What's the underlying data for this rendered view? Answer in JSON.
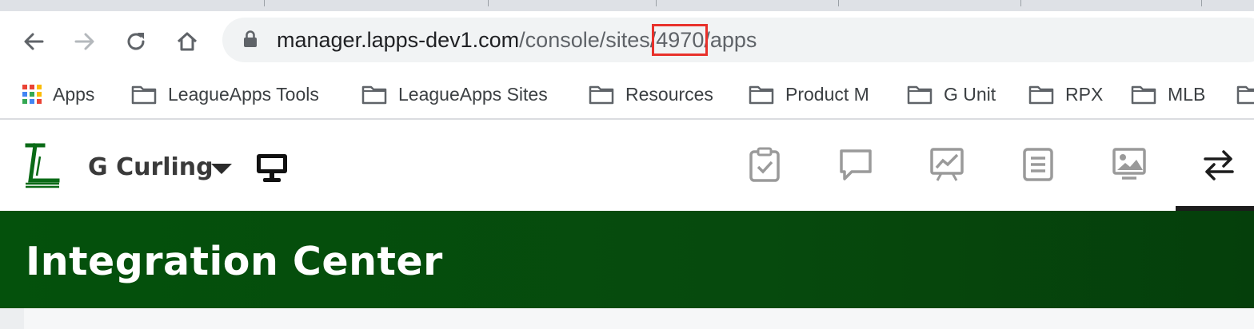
{
  "browser": {
    "url_host": "manager.lapps-dev1.com",
    "url_path_1": "/console/sites/",
    "url_site_id": "4970",
    "url_path_2": "/apps"
  },
  "bookmarks": [
    {
      "label": "Apps",
      "icon": "apps-grid-icon"
    },
    {
      "label": "LeagueApps Tools",
      "icon": "folder-icon"
    },
    {
      "label": "LeagueApps Sites",
      "icon": "folder-icon"
    },
    {
      "label": "Resources",
      "icon": "folder-icon"
    },
    {
      "label": "Product M",
      "icon": "folder-icon"
    },
    {
      "label": "G Unit",
      "icon": "folder-icon"
    },
    {
      "label": "RPX",
      "icon": "folder-icon"
    },
    {
      "label": "MLB",
      "icon": "folder-icon"
    }
  ],
  "app": {
    "site_name": "G Curling",
    "nav_icons": [
      "clipboard-check-icon",
      "chat-bubble-icon",
      "analytics-chart-icon",
      "list-document-icon",
      "image-gallery-icon",
      "integrations-arrows-icon"
    ],
    "active_nav": "integrations-arrows-icon"
  },
  "banner": {
    "title": "Integration Center"
  },
  "colors": {
    "brand_green": "#04510c",
    "highlight_red": "#e8312b"
  }
}
